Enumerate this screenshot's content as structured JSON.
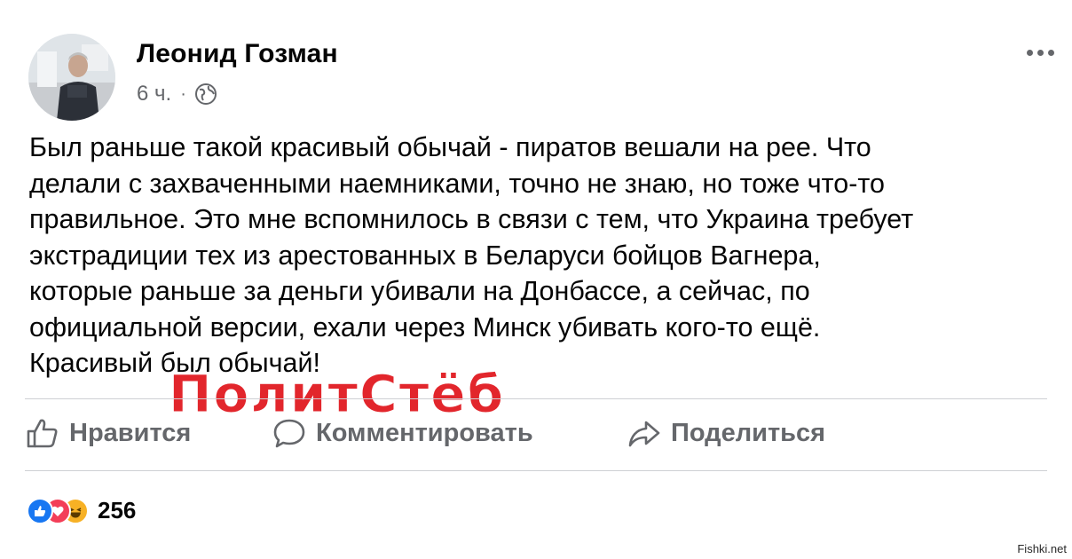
{
  "post": {
    "author": "Леонид Гозман",
    "time": "6 ч.",
    "separator": "·",
    "privacy_icon": "globe-icon",
    "more_icon": "more-dots-icon",
    "text_lines": [
      "Был раньше такой красивый обычай - пиратов вешали на рее. Что",
      "делали с захваченными наемниками, точно не знаю, но тоже что-то",
      "правильное. Это мне вспомнилось в связи с тем, что Украина требует",
      "экстрадиции тех из арестованных в Беларуси бойцов Вагнера,",
      "которые раньше за деньги убивали на Донбассе, а сейчас, по",
      "официальной версии, ехали через Минск убивать кого-то ещё.",
      "Красивый был обычай!"
    ]
  },
  "watermark": "ПолитСтёб",
  "actions": {
    "like": "Нравится",
    "comment": "Комментировать",
    "share": "Поделиться"
  },
  "reactions": {
    "icons": [
      "like-reaction-icon",
      "love-reaction-icon",
      "haha-reaction-icon"
    ],
    "count": "256"
  },
  "footer_mark": "Fishki.net",
  "colors": {
    "text": "#050505",
    "secondary": "#65676b",
    "divider": "#ced0d4",
    "like_blue": "#1877f2",
    "love_red": "#f33e58",
    "haha_yellow": "#f7b125",
    "watermark_red": "#e2262c"
  }
}
